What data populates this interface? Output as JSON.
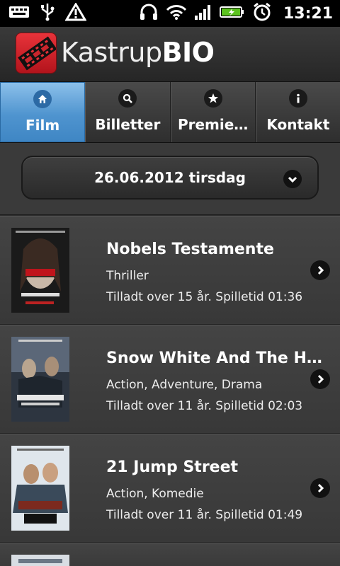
{
  "status_bar": {
    "time": "13:21",
    "left_icons": [
      "keyboard-icon",
      "usb-icon",
      "warning-icon"
    ],
    "right_icons": [
      "headset-icon",
      "wifi-icon",
      "signal-icon",
      "battery-icon",
      "alarm-icon"
    ]
  },
  "app": {
    "name_light": "Kastrup",
    "name_bold": "BIO",
    "logo_icon": "film-strip-icon"
  },
  "tabs": [
    {
      "label": "Film",
      "icon": "home-icon",
      "active": true
    },
    {
      "label": "Billetter",
      "icon": "search-icon",
      "active": false
    },
    {
      "label": "Premie…",
      "icon": "star-icon",
      "active": false
    },
    {
      "label": "Kontakt",
      "icon": "info-icon",
      "active": false
    }
  ],
  "date_selector": {
    "label": "26.06.2012 tirsdag",
    "icon": "chevron-down-icon"
  },
  "movies": [
    {
      "title": "Nobels Testamente",
      "genre": "Thriller",
      "info": "Tilladt over 15 år. Spilletid 01:36"
    },
    {
      "title": "Snow White And The H…",
      "genre": "Action, Adventure, Drama",
      "info": "Tilladt over 11 år. Spilletid 02:03"
    },
    {
      "title": "21 Jump Street",
      "genre": "Action, Komedie",
      "info": "Tilladt over 11 år. Spilletid 01:49"
    }
  ],
  "colors": {
    "accent": "#4f94cf",
    "logo_red": "#d8232a",
    "background": "#2b2b2b"
  }
}
